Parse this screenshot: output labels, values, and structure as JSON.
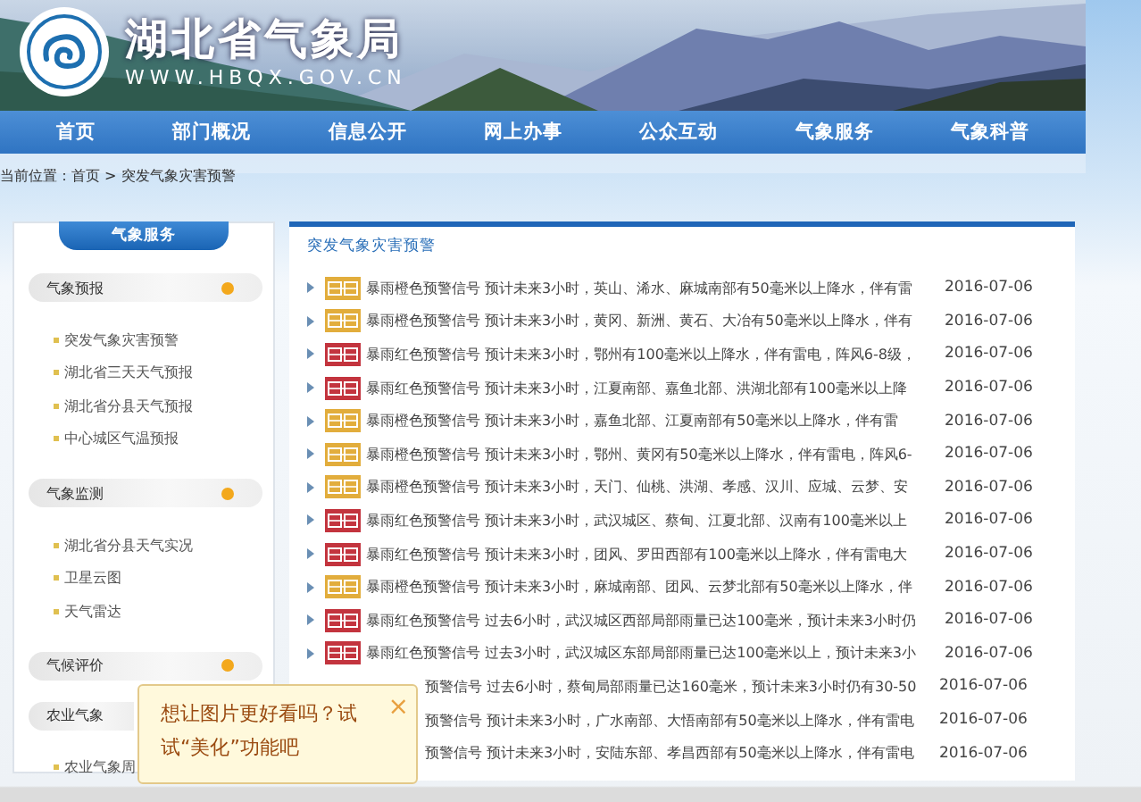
{
  "site": {
    "title": "湖北省气象局",
    "url": "WWW.HBQX.GOV.CN"
  },
  "nav": [
    "首页",
    "部门概况",
    "信息公开",
    "网上办事",
    "公众互动",
    "气象服务",
    "气象科普"
  ],
  "breadcrumb": "当前位置：首页 > 突发气象灾害预警",
  "sidebar": {
    "title": "气象服务",
    "groups": [
      {
        "label": "气象预报",
        "covered": false,
        "items": [
          "突发气象灾害预警",
          "湖北省三天天气预报",
          "湖北省分县天气预报",
          "中心城区气温预报"
        ]
      },
      {
        "label": "气象监测",
        "covered": false,
        "items": [
          "湖北省分县天气实况",
          "卫星云图",
          "天气雷达"
        ]
      },
      {
        "label": "气候评价",
        "covered": false
      },
      {
        "label": "农业气象",
        "covered": true,
        "items": [
          "农业气象周"
        ]
      }
    ]
  },
  "alerts": {
    "title": "突发气象灾害预警",
    "rows": [
      {
        "covered": false,
        "color": "#e2ad3c",
        "text": "暴雨橙色预警信号 预计未来3小时，英山、浠水、麻城南部有50毫米以上降水，伴有雷",
        "date": "2016-07-06"
      },
      {
        "covered": false,
        "color": "#e2ad3c",
        "text": "暴雨橙色预警信号 预计未来3小时，黄冈、新洲、黄石、大冶有50毫米以上降水，伴有",
        "date": "2016-07-06"
      },
      {
        "covered": false,
        "color": "#c3343e",
        "text": "暴雨红色预警信号 预计未来3小时，鄂州有100毫米以上降水，伴有雷电，阵风6-8级，",
        "date": "2016-07-06"
      },
      {
        "covered": false,
        "color": "#c3343e",
        "text": "暴雨红色预警信号 预计未来3小时，江夏南部、嘉鱼北部、洪湖北部有100毫米以上降",
        "date": "2016-07-06"
      },
      {
        "covered": false,
        "color": "#e2ad3c",
        "text": "暴雨橙色预警信号 预计未来3小时，嘉鱼北部、江夏南部有50毫米以上降水，伴有雷",
        "date": "2016-07-06"
      },
      {
        "covered": false,
        "color": "#e2ad3c",
        "text": "暴雨橙色预警信号 预计未来3小时，鄂州、黄冈有50毫米以上降水，伴有雷电，阵风6-",
        "date": "2016-07-06"
      },
      {
        "covered": false,
        "color": "#e2ad3c",
        "text": "暴雨橙色预警信号 预计未来3小时，天门、仙桃、洪湖、孝感、汉川、应城、云梦、安",
        "date": "2016-07-06"
      },
      {
        "covered": false,
        "color": "#c3343e",
        "text": "暴雨红色预警信号 预计未来3小时，武汉城区、蔡甸、江夏北部、汉南有100毫米以上",
        "date": "2016-07-06"
      },
      {
        "covered": false,
        "color": "#c3343e",
        "text": "暴雨红色预警信号 预计未来3小时，团风、罗田西部有100毫米以上降水，伴有雷电大",
        "date": "2016-07-06"
      },
      {
        "covered": false,
        "color": "#e2ad3c",
        "text": "暴雨橙色预警信号 预计未来3小时，麻城南部、团风、云梦北部有50毫米以上降水，伴",
        "date": "2016-07-06"
      },
      {
        "covered": false,
        "color": "#c3343e",
        "text": "暴雨红色预警信号 过去6小时，武汉城区西部局部雨量已达100毫米，预计未来3小时仍",
        "date": "2016-07-06"
      },
      {
        "covered": false,
        "color": "#c3343e",
        "text": "暴雨红色预警信号 过去3小时，武汉城区东部局部雨量已达100毫米以上，预计未来3小",
        "date": "2016-07-06"
      },
      {
        "covered": true,
        "text": "预警信号 过去6小时，蔡甸局部雨量已达160毫米，预计未来3小时仍有30-50",
        "date": "2016-07-06"
      },
      {
        "covered": true,
        "text": "预警信号 预计未来3小时，广水南部、大悟南部有50毫米以上降水，伴有雷电",
        "date": "2016-07-06"
      },
      {
        "covered": true,
        "text": "预警信号 预计未来3小时，安陆东部、孝昌西部有50毫米以上降水，伴有雷电",
        "date": "2016-07-06"
      }
    ]
  },
  "tip": {
    "text": "想让图片更好看吗？试试“美化”功能吧",
    "close": "×"
  }
}
